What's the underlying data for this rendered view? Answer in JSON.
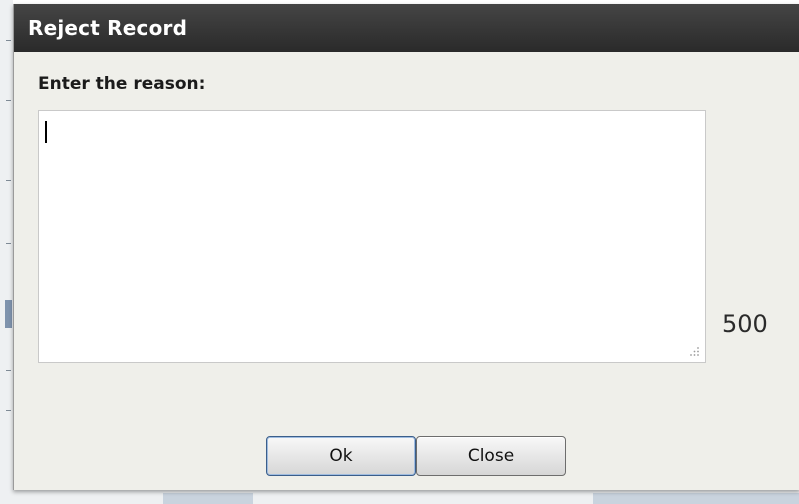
{
  "dialog": {
    "title": "Reject Record",
    "prompt_label": "Enter the reason:",
    "reason_input": {
      "value": "",
      "placeholder": ""
    },
    "remaining_characters": "500",
    "buttons": {
      "ok_label": "Ok",
      "close_label": "Close"
    }
  },
  "colors": {
    "titlebar": "#333333",
    "dialog_background": "#efefea",
    "primary_button_border": "#3b5e8a"
  }
}
